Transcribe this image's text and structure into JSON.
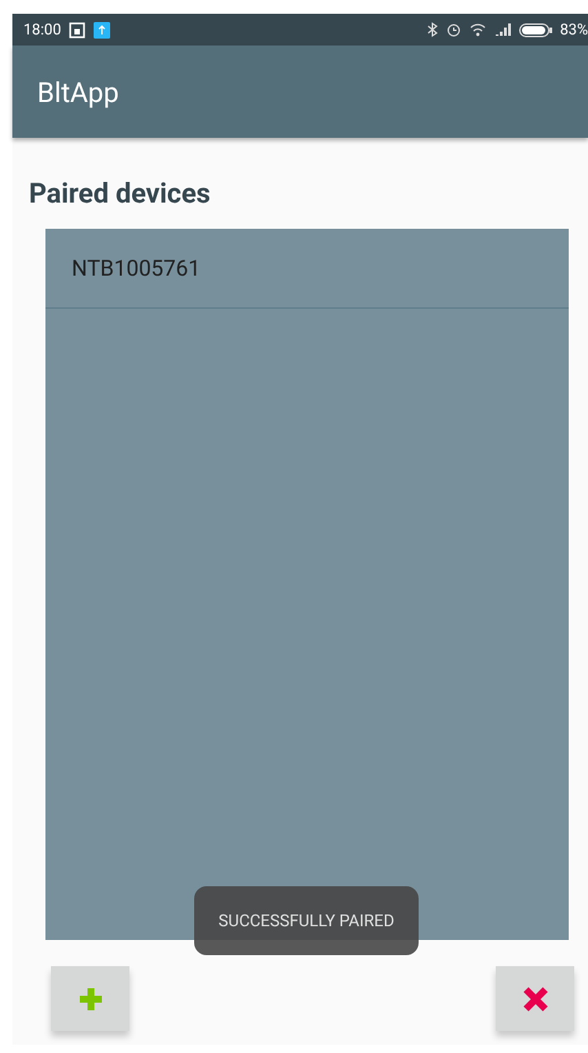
{
  "status_bar": {
    "time": "18:00",
    "battery": "83%"
  },
  "app_bar": {
    "title": "BltApp"
  },
  "section": {
    "title": "Paired devices"
  },
  "devices": [
    {
      "name": "NTB1005761"
    }
  ],
  "toast": {
    "text": "SUCCESSFULLY PAIRED"
  },
  "buttons": [
    {
      "kind": "add"
    },
    {
      "kind": "remove"
    }
  ]
}
